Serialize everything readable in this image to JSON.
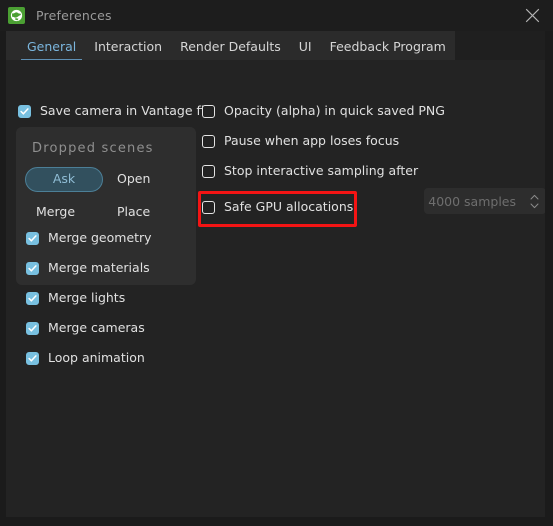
{
  "window": {
    "title": "Preferences",
    "app_icon": "vantage-globe-icon",
    "close_icon": "close-icon",
    "accent_color": "#7bb6de",
    "icon_color": "#4ba033",
    "annotation_color": "#f41414",
    "background_color": "#232323"
  },
  "tabs": [
    {
      "label": "General",
      "active": true
    },
    {
      "label": "Interaction",
      "active": false
    },
    {
      "label": "Render Defaults",
      "active": false
    },
    {
      "label": "UI",
      "active": false
    },
    {
      "label": "Feedback Program",
      "active": false
    }
  ],
  "left_column": {
    "save_camera": {
      "label": "Save camera in Vantage file",
      "checked": true
    }
  },
  "dropped_scenes_panel": {
    "title": "Dropped scenes",
    "options": [
      {
        "label": "Ask",
        "selected": true
      },
      {
        "label": "Open",
        "selected": false
      },
      {
        "label": "Merge",
        "selected": false
      },
      {
        "label": "Place",
        "selected": false
      }
    ],
    "checkboxes": [
      {
        "label": "Merge geometry",
        "checked": true
      },
      {
        "label": "Merge materials",
        "checked": true
      },
      {
        "label": "Merge lights",
        "checked": true
      },
      {
        "label": "Merge cameras",
        "checked": true
      },
      {
        "label": "Loop animation",
        "checked": true
      }
    ]
  },
  "right_column": {
    "checkboxes": [
      {
        "label": "Opacity (alpha) in quick saved PNG",
        "checked": false
      },
      {
        "label": "Pause when app loses focus",
        "checked": false
      },
      {
        "label": "Stop interactive sampling after",
        "checked": false
      },
      {
        "label": "Safe GPU allocations",
        "checked": false,
        "highlighted": true
      }
    ],
    "samples_spinner": {
      "value": "4000 samples",
      "placeholder": "4000 samples",
      "up_icon": "chevron-up-icon",
      "down_icon": "chevron-down-icon"
    }
  }
}
